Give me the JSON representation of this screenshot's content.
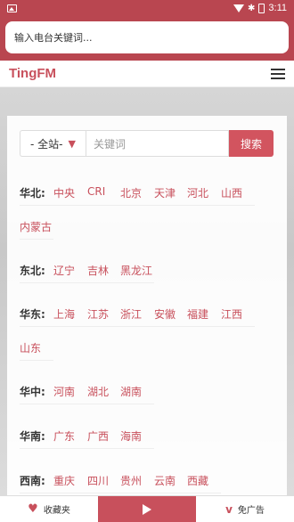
{
  "status_bar": {
    "time": "3:11"
  },
  "search": {
    "placeholder": "输入电台关键词..."
  },
  "nav": {
    "brand": "TingFM"
  },
  "form": {
    "scope": "- 全站-",
    "keyword_placeholder": "关键词",
    "button": "搜索"
  },
  "regions": [
    {
      "label": "华北:",
      "items": [
        "中央",
        "CRI",
        "北京",
        "天津",
        "河北",
        "山西",
        "内蒙古"
      ]
    },
    {
      "label": "东北:",
      "items": [
        "辽宁",
        "吉林",
        "黑龙江"
      ]
    },
    {
      "label": "华东:",
      "items": [
        "上海",
        "江苏",
        "浙江",
        "安徽",
        "福建",
        "江西",
        "山东"
      ]
    },
    {
      "label": "华中:",
      "items": [
        "河南",
        "湖北",
        "湖南"
      ]
    },
    {
      "label": "华南:",
      "items": [
        "广东",
        "广西",
        "海南"
      ]
    },
    {
      "label": "西南:",
      "items": [
        "重庆",
        "四川",
        "贵州",
        "云南",
        "西藏"
      ]
    }
  ],
  "bottom": {
    "favorites": "收藏夹",
    "adfree": "免广告"
  },
  "colors": {
    "accent": "#c8505c",
    "status": "#b94650"
  }
}
